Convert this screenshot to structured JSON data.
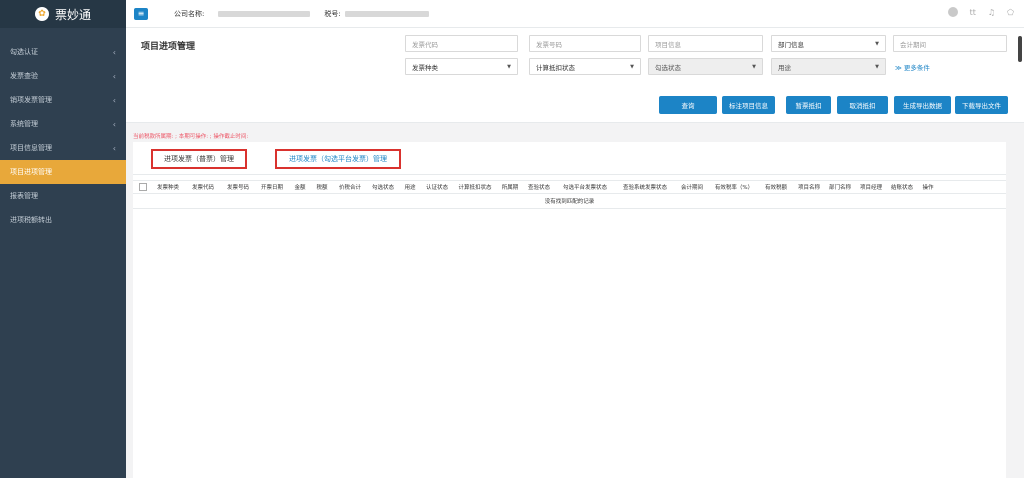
{
  "app": {
    "name": "票妙通"
  },
  "sidebar": {
    "items": [
      {
        "label": "勾选认证",
        "has_chevron": true
      },
      {
        "label": "发票查验",
        "has_chevron": true
      },
      {
        "label": "销项发票管理",
        "has_chevron": true
      },
      {
        "label": "系统管理",
        "has_chevron": true
      },
      {
        "label": "项目信息管理",
        "has_chevron": true
      },
      {
        "label": "项目进项管理",
        "active": true
      },
      {
        "label": "报表管理"
      },
      {
        "label": "进项税额转出"
      }
    ],
    "chevron": "‹"
  },
  "topbar": {
    "company_label": "公司名称:",
    "tax_label": "税号:",
    "lang": "tt"
  },
  "page": {
    "title": "项目进项管理",
    "info_line": "当前税款所属期: ; 本期可操作: ; 操作截止时间:"
  },
  "filters": {
    "invoice_code": "发票代码",
    "invoice_number": "发票号码",
    "project_info": "项目信息",
    "department": "部门信息",
    "accounting_period": "会计期间",
    "invoice_type": "发票种类",
    "deduction_status": "计算抵扣状态",
    "check_status": "勾选状态",
    "usage": "用途",
    "more": "更多条件"
  },
  "buttons": {
    "query": "查询",
    "mark_project": "标注项目信息",
    "deduct": "暂票抵扣",
    "cancel_deduct": "取消抵扣",
    "export_data": "生成导出数据",
    "download": "下载导出文件"
  },
  "tabs": {
    "regular": "进项发票（普票）管理",
    "platform": "进项发票（勾选平台发票）管理"
  },
  "table": {
    "columns": [
      "发票种类",
      "发票代码",
      "发票号码",
      "开票日期",
      "金额",
      "税额",
      "价税合计",
      "勾选状态",
      "用途",
      "认证状态",
      "计算抵扣状态",
      "所属期",
      "查验状态",
      "勾选平台发票状态",
      "查验系统发票状态",
      "会计期间",
      "有效税率（%）",
      "有效税额",
      "项目名称",
      "部门名称",
      "项目经理",
      "结账状态",
      "操作"
    ],
    "empty_message": "没有找到匹配的记录"
  },
  "colors": {
    "sidebar_bg": "#2f4050",
    "active_item": "#e8a83a",
    "primary": "#1c84c6",
    "tab_border": "#d9322e"
  }
}
